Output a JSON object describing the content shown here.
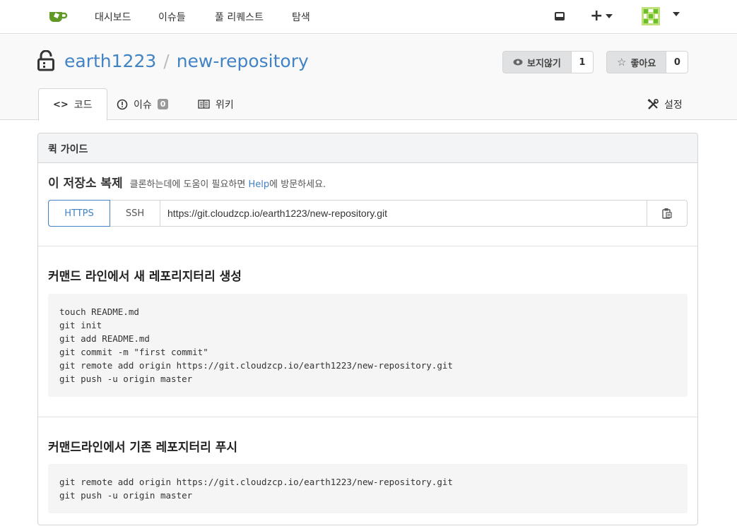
{
  "nav": {
    "items": [
      "대시보드",
      "이슈들",
      "풀 리퀘스트",
      "탐색"
    ],
    "plus": "+"
  },
  "repo": {
    "owner": "earth1223",
    "separator": "/",
    "name": "new-repository",
    "watch_label": "보지않기",
    "watch_count": "1",
    "star_label": "좋아요",
    "star_count": "0"
  },
  "tabs": {
    "code": "코드",
    "issues": "이슈",
    "issues_count": "0",
    "wiki": "위키",
    "settings": "설정"
  },
  "guide": {
    "header": "퀵 가이드",
    "clone_title": "이 저장소 복제",
    "clone_sub_before": "클론하는데에 도움이 필요하면",
    "clone_help_link": "Help",
    "clone_sub_after": "에 방문하세요.",
    "https_label": "HTTPS",
    "ssh_label": "SSH",
    "clone_url": "https://git.cloudzcp.io/earth1223/new-repository.git",
    "new_repo_title": "커맨드 라인에서 새 레포리지터리 생성",
    "new_repo_code": "touch README.md\ngit init\ngit add README.md\ngit commit -m \"first commit\"\ngit remote add origin https://git.cloudzcp.io/earth1223/new-repository.git\ngit push -u origin master",
    "push_title": "커맨드라인에서 기존 레포지터리 푸시",
    "push_code": "git remote add origin https://git.cloudzcp.io/earth1223/new-repository.git\ngit push -u origin master"
  },
  "colors": {
    "link": "#4183c4",
    "logo_green": "#609926"
  }
}
